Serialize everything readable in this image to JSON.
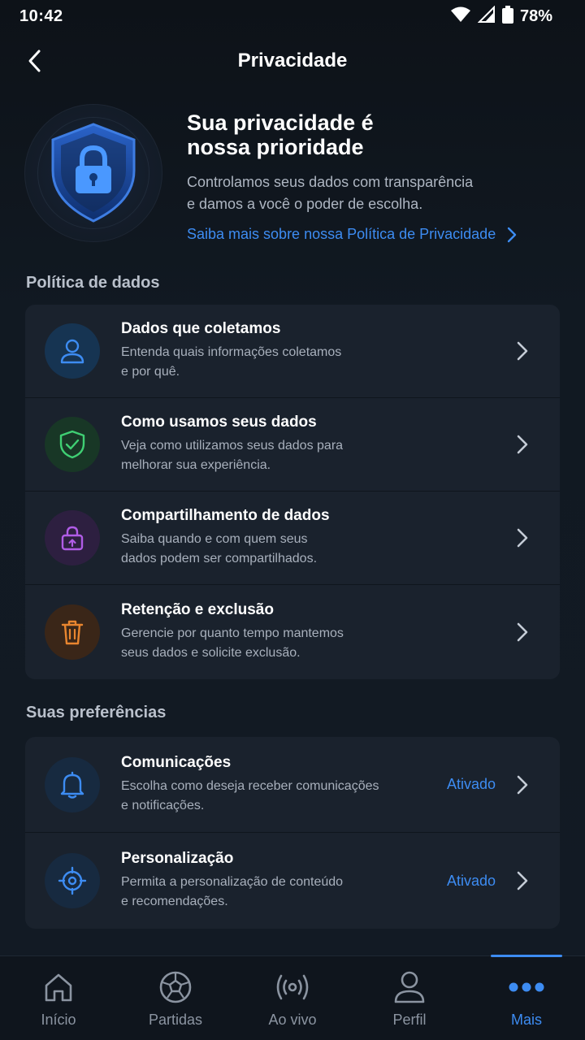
{
  "status_bar": {
    "time": "10:42",
    "battery": "78%"
  },
  "header": {
    "title": "Privacidade"
  },
  "hero": {
    "title_line1": "Sua privacidade é",
    "title_line2": "nossa prioridade",
    "desc_line1": "Controlamos seus dados com transparência",
    "desc_line2": "e damos a você o poder de escolha.",
    "link": "Saiba mais sobre nossa Política de Privacidade"
  },
  "sections": {
    "policy": {
      "title": "Política de dados",
      "items": [
        {
          "icon": "user-icon",
          "title": "Dados que coletamos",
          "line1": "Entenda quais informações coletamos",
          "line2": "e por quê."
        },
        {
          "icon": "shield-check-icon",
          "title": "Como usamos seus dados",
          "line1": "Veja como utilizamos seus dados para",
          "line2": "melhorar sua experiência."
        },
        {
          "icon": "lock-share-icon",
          "title": "Compartilhamento de dados",
          "line1": "Saiba quando e com quem seus",
          "line2": "dados podem ser compartilhados."
        },
        {
          "icon": "trash-icon",
          "title": "Retenção e exclusão",
          "line1": "Gerencie por quanto tempo mantemos",
          "line2": "seus dados e solicite exclusão."
        }
      ]
    },
    "preferences": {
      "title": "Suas preferências",
      "items": [
        {
          "icon": "bell-icon",
          "title": "Comunicações",
          "line1": "Escolha como deseja receber comunicações",
          "line2": "e notificações.",
          "status": "Ativado"
        },
        {
          "icon": "target-icon",
          "title": "Personalização",
          "line1": "Permita a personalização de conteúdo",
          "line2": "e recomendações.",
          "status": "Ativado"
        }
      ]
    }
  },
  "bottom_nav": {
    "items": [
      {
        "icon": "home-icon",
        "label": "Início"
      },
      {
        "icon": "ball-icon",
        "label": "Partidas"
      },
      {
        "icon": "broadcast-icon",
        "label": "Ao vivo"
      },
      {
        "icon": "profile-icon",
        "label": "Perfil"
      },
      {
        "icon": "more-icon",
        "label": "Mais"
      }
    ],
    "active": "Mais"
  },
  "colors": {
    "accent": "#3d8cf2",
    "green": "#3fcf73",
    "purple": "#b05ce6",
    "orange": "#e8852f"
  }
}
